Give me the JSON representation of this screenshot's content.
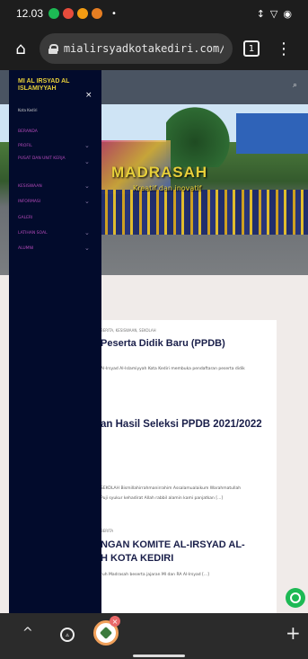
{
  "status_bar": {
    "time": "12.03",
    "notification_dots": [
      "#1db954",
      "#e74c3c",
      "#f39c12",
      "#e67e22"
    ]
  },
  "browser": {
    "url": "mialirsyadkotakediri.com/wp/",
    "tab_count": "1"
  },
  "sidebar": {
    "title": "MI AL IRSYAD AL ISLAMIYYAH",
    "subtitle": "Kota Kediri",
    "close": "×",
    "items": [
      {
        "label": "BERANDA",
        "has_submenu": false
      },
      {
        "label": "PROFIL",
        "has_submenu": true
      },
      {
        "label": "PUSAT DAN UNIT KERJA",
        "has_submenu": true
      },
      {
        "label": "KESISWAAN",
        "has_submenu": true
      },
      {
        "label": "INFORMASI",
        "has_submenu": true
      },
      {
        "label": "GALERI",
        "has_submenu": false
      },
      {
        "label": "LATIHAN SOAL",
        "has_submenu": true
      },
      {
        "label": "ALUMNI",
        "has_submenu": true
      }
    ]
  },
  "hero": {
    "title": "MADRASAH",
    "subtitle": "Kreatif dan inovatif"
  },
  "posts": [
    {
      "meta": "BERITA, KESISWAAN, SEKOLAH",
      "title": "Peserta Didik Baru (PPDB)",
      "excerpt": "Al-Irsyad Al-Islamiyyah Kota Kediri membuka pendaftaran peserta didik"
    },
    {
      "meta": "",
      "title": "an Hasil Seleksi PPDB 2021/2022",
      "excerpt": "SEKOLAH Bismillahirrahmanirrahim Assalamualaikum Warahmatullah",
      "excerpt2": "Puji syukur kehadirat Allah rabbil alamin kami panjatkan [...]"
    },
    {
      "meta": "BERITA",
      "title": "NGAN KOMITE AL-IRSYAD AL-",
      "title2": "H KOTA KEDIRI",
      "excerpt": "ruh Madrasah beserta jajaran MI dan RA Al-Irsyad [...]"
    }
  ],
  "bottom_bar": {
    "plus": "+",
    "up": "^"
  }
}
